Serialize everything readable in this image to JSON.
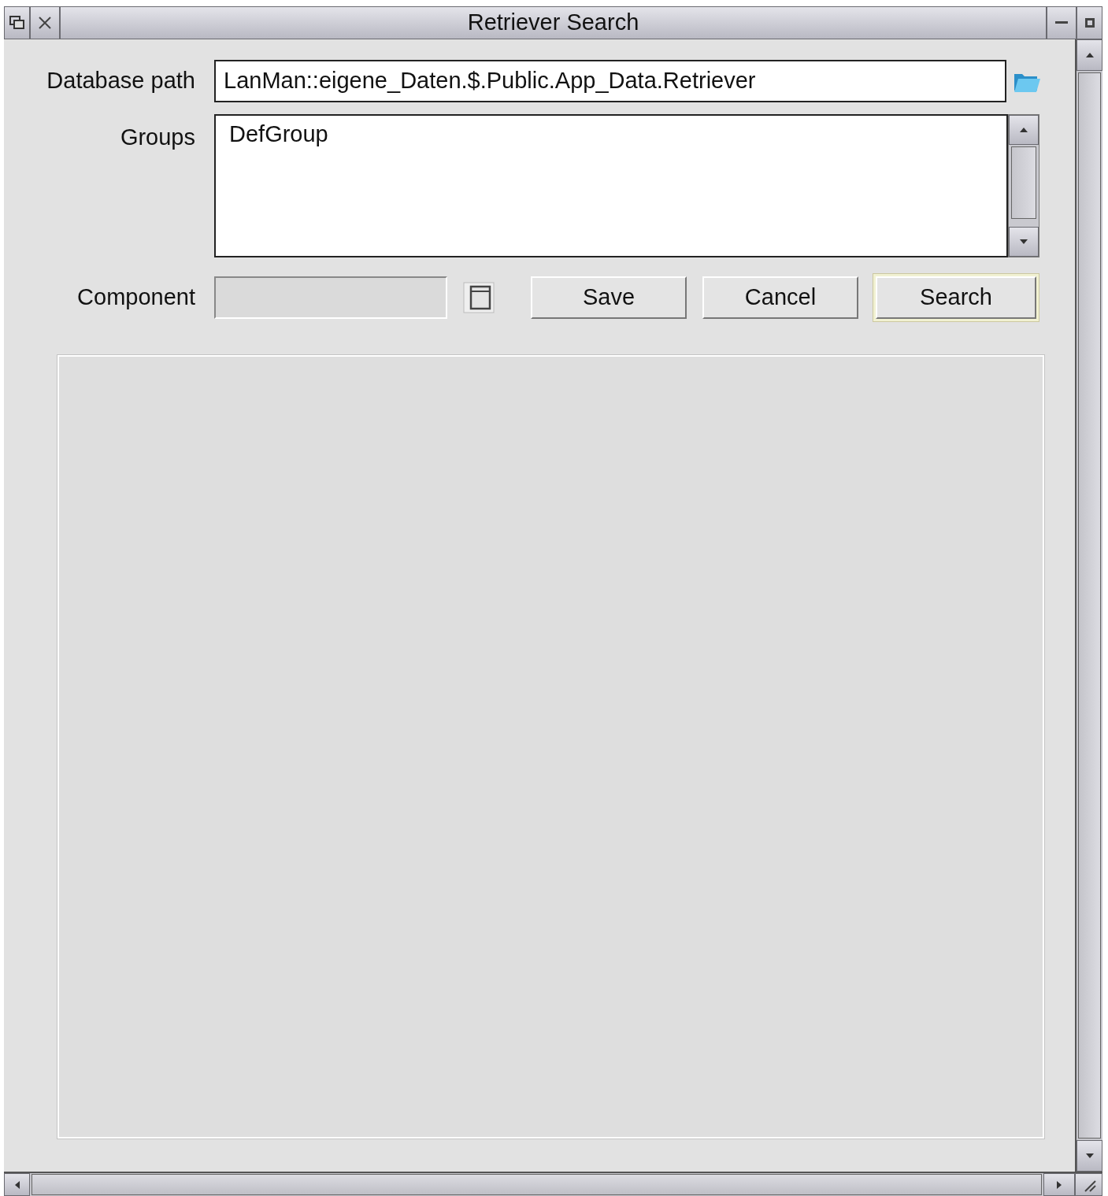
{
  "window": {
    "title": "Retriever Search"
  },
  "database_path": {
    "label": "Database path",
    "value": "LanMan::eigene_Daten.$.Public.App_Data.Retriever"
  },
  "groups": {
    "label": "Groups",
    "items": [
      {
        "text": "DefGroup",
        "selected": false
      }
    ]
  },
  "component": {
    "label": "Component",
    "disabled": true
  },
  "buttons": [
    {
      "label": "Save",
      "default": false
    },
    {
      "label": "Cancel",
      "default": false
    },
    {
      "label": "Search",
      "default": true
    }
  ]
}
